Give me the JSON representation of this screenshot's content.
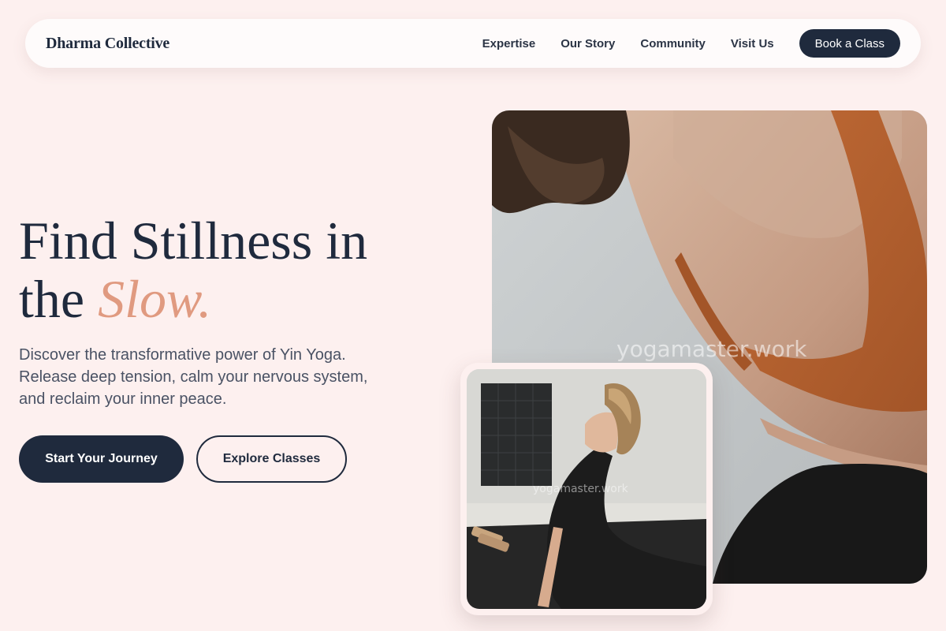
{
  "nav": {
    "brand": "Dharma Collective",
    "links": [
      "Expertise",
      "Our Story",
      "Community",
      "Visit Us"
    ],
    "cta": "Book a Class"
  },
  "hero": {
    "title_line1": "Find Stillness in",
    "title_line2_prefix": "the ",
    "title_accent": "Slow.",
    "subtitle": "Discover the transformative power of Yin Yoga. Release deep tension, calm your nervous system, and reclaim your inner peace.",
    "primary_button": "Start Your Journey",
    "secondary_button": "Explore Classes"
  },
  "images": {
    "main_watermark": "yogamaster.work",
    "small_watermark": "yogamaster.work"
  },
  "colors": {
    "background": "#fdf0ef",
    "primary": "#1f2a3d",
    "accent": "#e09a80"
  }
}
